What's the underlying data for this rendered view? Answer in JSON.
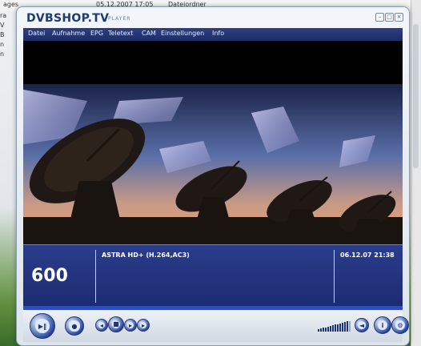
{
  "background": {
    "top_items": [
      "ages",
      "05.12.2007 17:05",
      "Dateiordner"
    ],
    "left_items": [
      "ra",
      "V",
      "B",
      "n",
      "n"
    ]
  },
  "window": {
    "brand": "DVBSHOP.TV",
    "brand_sub": "PLAYER",
    "controls": [
      "minimize-icon",
      "maximize-icon",
      "close-icon"
    ]
  },
  "menu": {
    "items": [
      "Datei",
      "Aufnahme",
      "EPG",
      "Teletext",
      "CAM",
      "Einstellungen",
      "Info"
    ]
  },
  "info_panel": {
    "channel_number": "600",
    "channel_name": "ASTRA HD+ (H.264,AC3)",
    "datetime": "06.12.07 21:38"
  },
  "controls": {
    "buttons": [
      "play-pause-icon",
      "stop-icon",
      "previous-icon",
      "record-icon",
      "next-icon",
      "next-end-icon",
      "volume-icon",
      "info-icon",
      "settings-icon"
    ],
    "volume_level": 0.9
  },
  "colors": {
    "menu_bg": "#1e2d66",
    "info_bg": "#1c2a6e",
    "accent": "#2b4dbd"
  }
}
